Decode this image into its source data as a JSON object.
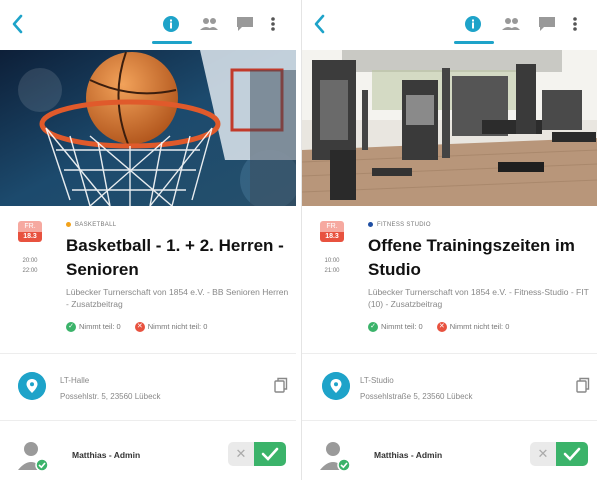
{
  "colors": {
    "accent": "#1ea3c9",
    "yes": "#3bb36a",
    "no": "#e8523f",
    "date_header": "#f6a9a0"
  },
  "left": {
    "date": {
      "day": "FR.",
      "num": "18.3"
    },
    "times": {
      "start": "20:00",
      "end": "22:00"
    },
    "category": {
      "label": "BASKETBALL",
      "dot_color": "#f2a21b"
    },
    "title": "Basketball - 1. + 2. Herren - Senioren",
    "org": "Lübecker Turnerschaft von 1854 e.V. - BB Senioren Herren - Zusatzbeitrag",
    "status": {
      "yes": "Nimmt teil: 0",
      "no": "Nimmt nicht teil: 0"
    },
    "location": {
      "name": "LT-Halle",
      "address": "Possehlstr. 5, 23560 Lübeck"
    },
    "user": {
      "name": "Matthias - Admin"
    }
  },
  "right": {
    "date": {
      "day": "FR.",
      "num": "18.3"
    },
    "times": {
      "start": "10:00",
      "end": "21:00"
    },
    "category": {
      "label": "FITNESS STUDIO",
      "dot_color": "#1f4fa3"
    },
    "title": "Offene Trainingszeiten im Studio",
    "org": "Lübecker Turnerschaft von 1854 e.V. - Fitness-Studio - FIT (10) - Zusatzbeitrag",
    "status": {
      "yes": "Nimmt teil: 0",
      "no": "Nimmt nicht teil: 0"
    },
    "location": {
      "name": "LT-Studio",
      "address": "Possehlstraße 5, 23560 Lübeck"
    },
    "user": {
      "name": "Matthias - Admin"
    }
  },
  "icons": {
    "back": "chevron-left-icon",
    "info": "info-icon",
    "people": "people-icon",
    "chat": "chat-icon",
    "more": "more-vertical-icon",
    "pin": "location-pin-icon",
    "copy": "copy-icon",
    "avatar": "user-avatar-icon",
    "toggle_off": "x-icon",
    "toggle_on": "check-icon"
  }
}
